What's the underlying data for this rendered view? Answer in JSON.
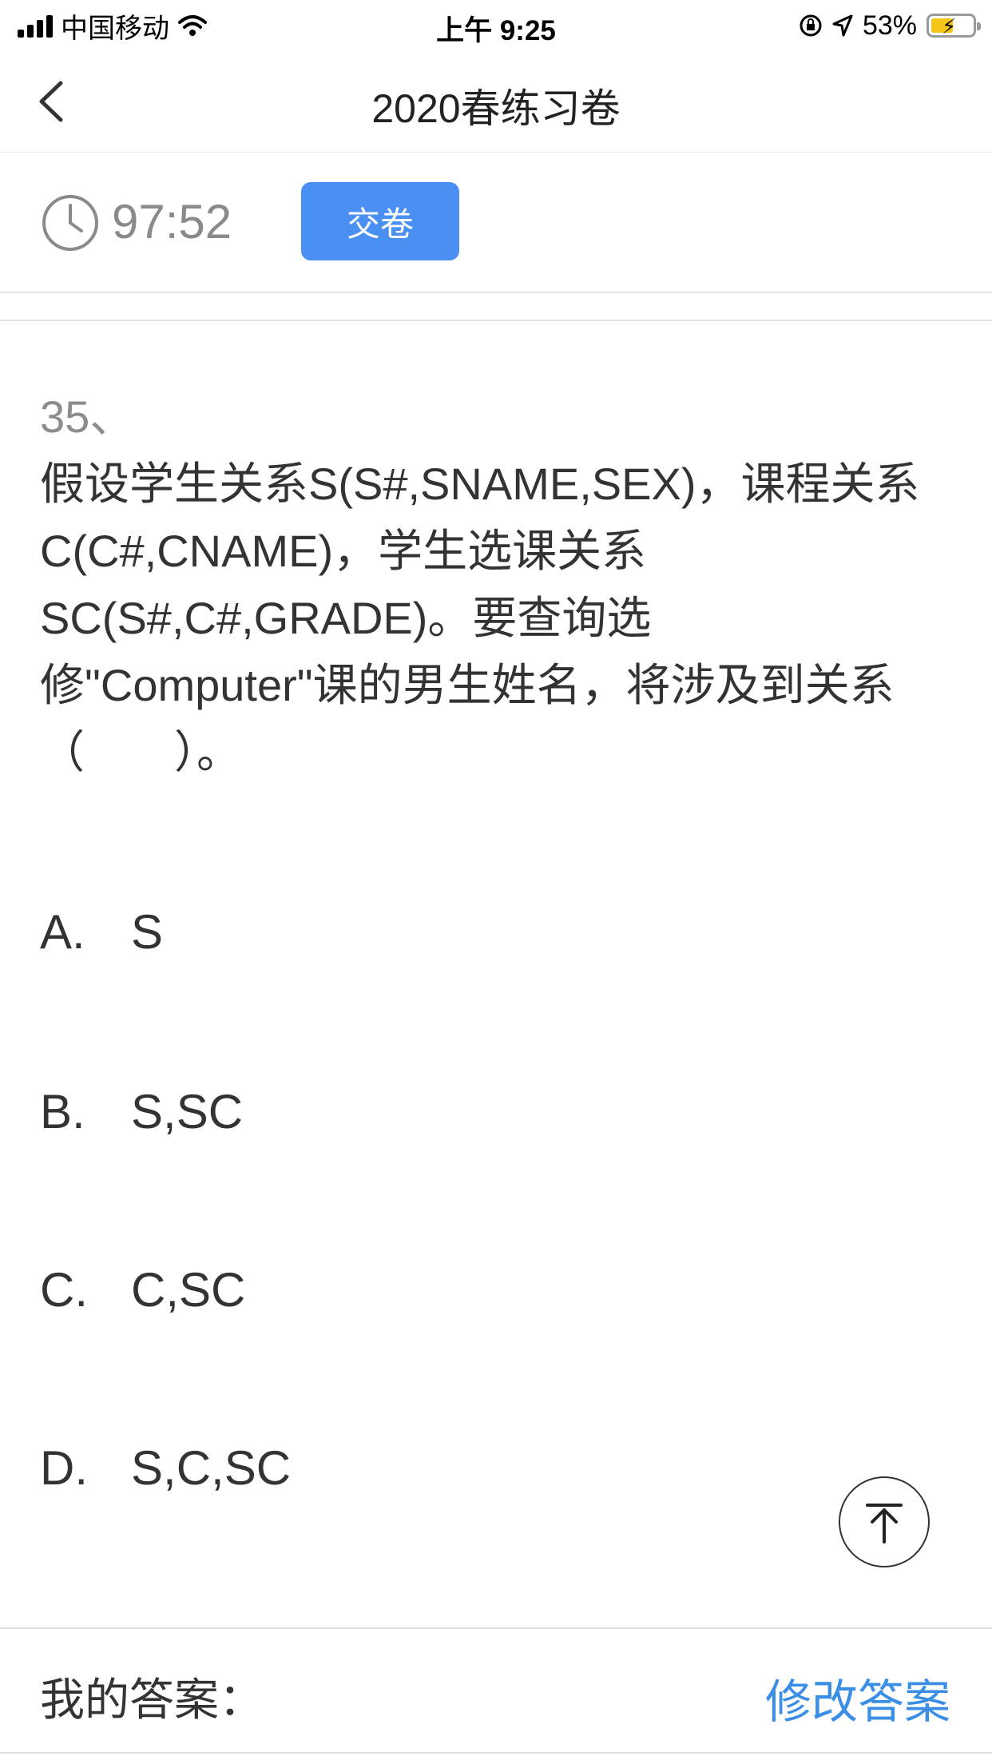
{
  "status_bar": {
    "carrier": "中国移动",
    "time": "上午 9:25",
    "battery_percent": "53%",
    "battery_level": 0.53,
    "icons": [
      "signal-icon",
      "wifi-icon",
      "orientation-lock-icon",
      "location-icon",
      "battery-icon"
    ]
  },
  "nav": {
    "title": "2020春练习卷",
    "back_icon": "chevron-left-icon"
  },
  "toolbar": {
    "timer": "97:52",
    "submit_label": "交卷",
    "clock_icon": "clock-icon"
  },
  "question": {
    "number": "35、",
    "stem": "假设学生关系S(S#,SNAME,SEX)，课程关系C(C#,CNAME)，学生选课关系SC(S#,C#,GRADE)。要查询选修\"Computer\"课的男生姓名，将涉及到关系（　　）。",
    "options": [
      {
        "letter": "A.",
        "text": "S"
      },
      {
        "letter": "B.",
        "text": "S,SC"
      },
      {
        "letter": "C.",
        "text": "C,SC"
      },
      {
        "letter": "D.",
        "text": "S,C,SC"
      }
    ]
  },
  "answer_bar": {
    "label": "我的答案：",
    "edit_label": "修改答案"
  },
  "colors": {
    "accent": "#4a8ff2",
    "link": "#3a8ee6",
    "muted_text": "#8a8a8a",
    "text": "#333333"
  }
}
